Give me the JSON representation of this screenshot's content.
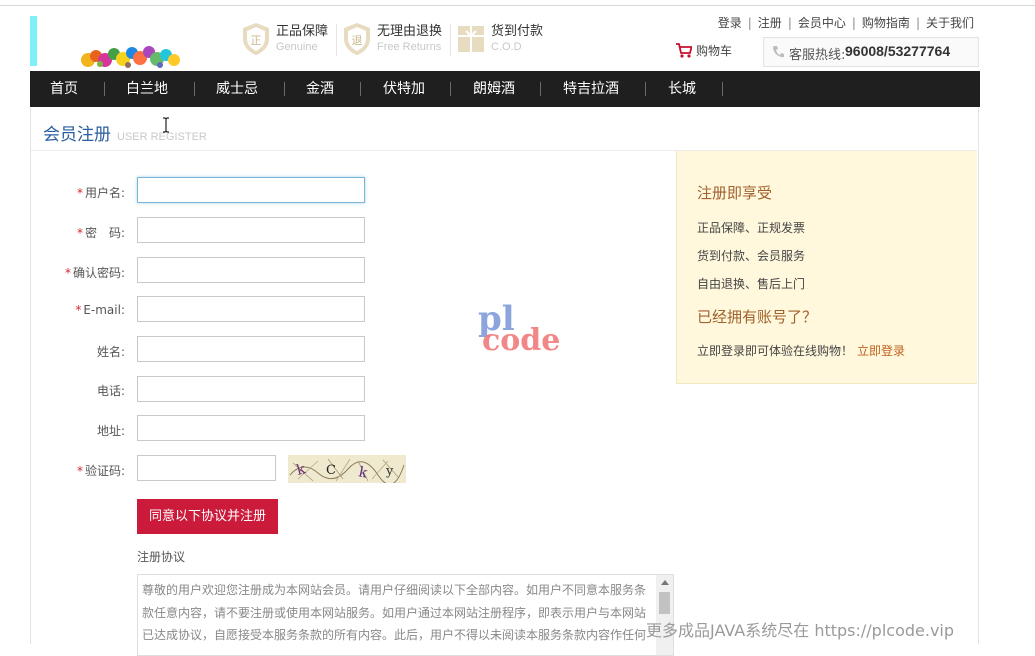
{
  "header": {
    "badges": [
      {
        "title": "正品保障",
        "subtitle": "Genuine",
        "icon": "shield-genuine-icon"
      },
      {
        "title": "无理由退换",
        "subtitle": "Free Returns",
        "icon": "shield-return-icon"
      },
      {
        "title": "货到付款",
        "subtitle": "C.O.D",
        "icon": "cod-box-icon"
      }
    ],
    "top_links": [
      "登录",
      "注册",
      "会员中心",
      "购物指南",
      "关于我们"
    ],
    "cart_label": "购物车",
    "hotline_label": "客服热线:",
    "hotline_number": "96008/53277764"
  },
  "nav": {
    "items": [
      "首页",
      "白兰地",
      "威士忌",
      "金酒",
      "伏特加",
      "朗姆酒",
      "特吉拉酒",
      "长城"
    ]
  },
  "page": {
    "title": "会员注册",
    "title_en": "USER REGISTER"
  },
  "form": {
    "fields": [
      {
        "label": "用户名:",
        "required": true,
        "value": ""
      },
      {
        "label": "密　码:",
        "required": true,
        "value": ""
      },
      {
        "label": "确认密码:",
        "required": true,
        "value": ""
      },
      {
        "label": "E-mail:",
        "required": true,
        "value": ""
      },
      {
        "label": "姓名:",
        "required": false,
        "value": ""
      },
      {
        "label": "电话:",
        "required": false,
        "value": ""
      },
      {
        "label": "地址:",
        "required": false,
        "value": ""
      },
      {
        "label": "验证码:",
        "required": true,
        "value": ""
      }
    ],
    "required_mark": "*",
    "submit_label": "同意以下协议并注册",
    "agreement_title": "注册协议",
    "agreement_lines": [
      "尊敬的用户欢迎您注册成为本网站会员。请用户仔细阅读以下全部内容。如用户不同意本服务条",
      "款任意内容，请不要注册或使用本网站服务。如用户通过本网站注册程序，即表示用户与本网站",
      "已达成协议，自愿接受本服务条款的所有内容。此后，用户不得以未阅读本服务条款内容作任何"
    ]
  },
  "sidebar": {
    "title": "注册即享受",
    "benefits": [
      "正品保障、正规发票",
      "货到付款、会员服务",
      "自由退换、售后上门"
    ],
    "account_title": "已经拥有账号了？",
    "login_text": "立即登录即可体验在线购物！",
    "login_link": "立即登录"
  },
  "watermark": {
    "logo_top": "pl",
    "logo_bottom": "code",
    "footer": "更多成品JAVA系统尽在 https://plcode.vip"
  },
  "colors": {
    "nav_bg": "#1f1f1f",
    "submit_bg": "#cc1a3a",
    "title_blue": "#2a5d9f",
    "sidebar_bg": "#fff8dc",
    "accent_brown": "#a0612d",
    "required_red": "#d2272d"
  }
}
